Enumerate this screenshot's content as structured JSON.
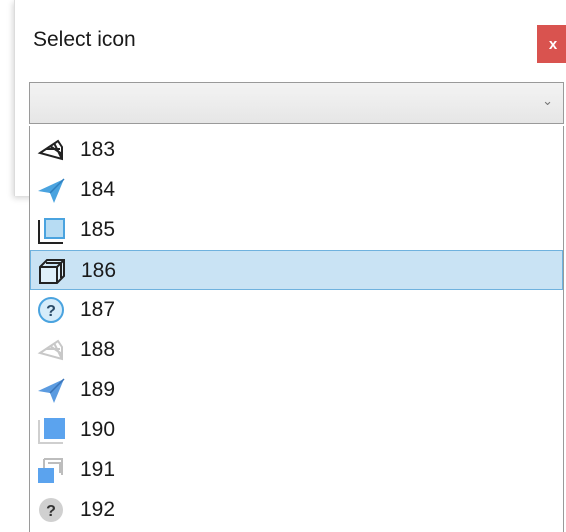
{
  "dialog": {
    "title": "Select icon",
    "close_label": "x",
    "select_value": "",
    "chevron": "⌄"
  },
  "items": [
    {
      "label": "183",
      "icon": "isometric-grid-icon"
    },
    {
      "label": "184",
      "icon": "paper-plane-icon"
    },
    {
      "label": "185",
      "icon": "square-corner-icon"
    },
    {
      "label": "186",
      "icon": "cube-icon",
      "selected": true
    },
    {
      "label": "187",
      "icon": "question-icon"
    },
    {
      "label": "188",
      "icon": "isometric-grid-faded-icon"
    },
    {
      "label": "189",
      "icon": "paper-plane-blue-icon"
    },
    {
      "label": "190",
      "icon": "square-corner-blue-icon"
    },
    {
      "label": "191",
      "icon": "cube-faded-icon"
    },
    {
      "label": "192",
      "icon": "question-gray-icon"
    }
  ],
  "colors": {
    "selection_bg": "#c9e3f4",
    "selection_border": "#6fb2de",
    "close_bg": "#d9534f",
    "icon_blue": "#4aa3df"
  }
}
